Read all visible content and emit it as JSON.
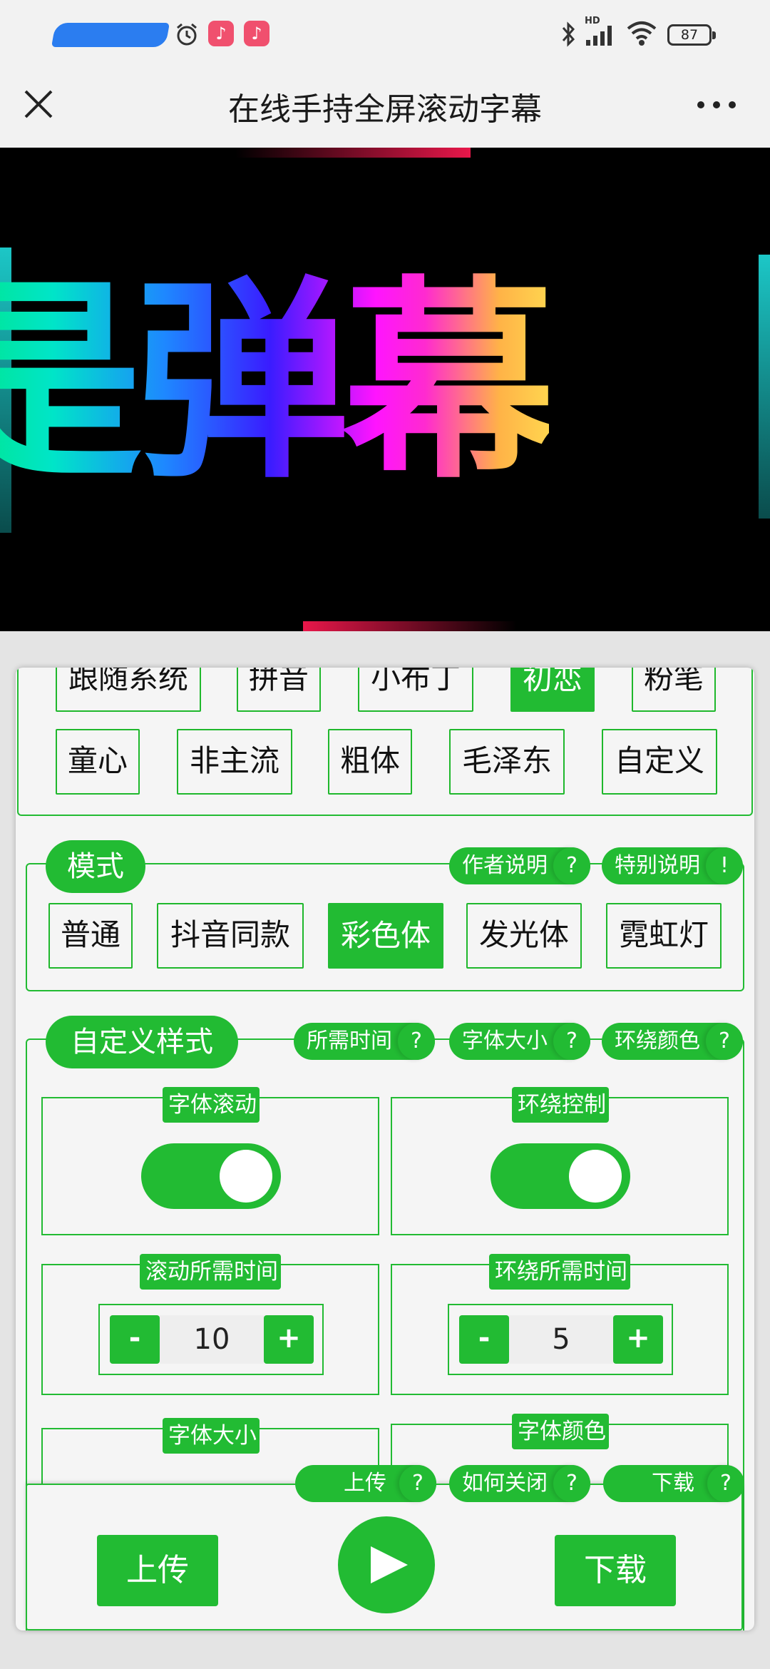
{
  "statusbar": {
    "battery": "87",
    "network": "HD",
    "app_icon_glyph": "♪"
  },
  "nav": {
    "title": "在线手持全屏滚动字幕"
  },
  "preview": {
    "text": "是弹幕"
  },
  "fonts_row1": [
    "跟随系统",
    "拼音",
    "小布丁",
    "初恋",
    "粉笔"
  ],
  "fonts_row2": [
    "童心",
    "非主流",
    "粗体",
    "毛泽东",
    "自定义"
  ],
  "mode": {
    "title": "模式",
    "help1": "作者说明",
    "help1_mark": "?",
    "help2": "特别说明",
    "help2_mark": "!",
    "options": [
      "普通",
      "抖音同款",
      "彩色体",
      "发光体",
      "霓虹灯"
    ],
    "selected": "彩色体"
  },
  "custom": {
    "title": "自定义样式",
    "help1": "所需时间",
    "help2": "字体大小",
    "help3": "环绕颜色",
    "q": "?",
    "scroll_label": "字体滚动",
    "wrap_label": "环绕控制",
    "scroll_time_label": "滚动所需时间",
    "wrap_time_label": "环绕所需时间",
    "scroll_time": "10",
    "wrap_time": "5",
    "minus": "-",
    "plus": "+",
    "font_size_label": "字体大小",
    "font_color_label": "字体颜色"
  },
  "bottom": {
    "help1": "上传",
    "help2": "如何关闭",
    "help3": "下载",
    "q": "?",
    "upload": "上传",
    "download": "下载"
  },
  "colors": {
    "accent": "#22bb33",
    "background": "#f5f5f5"
  }
}
